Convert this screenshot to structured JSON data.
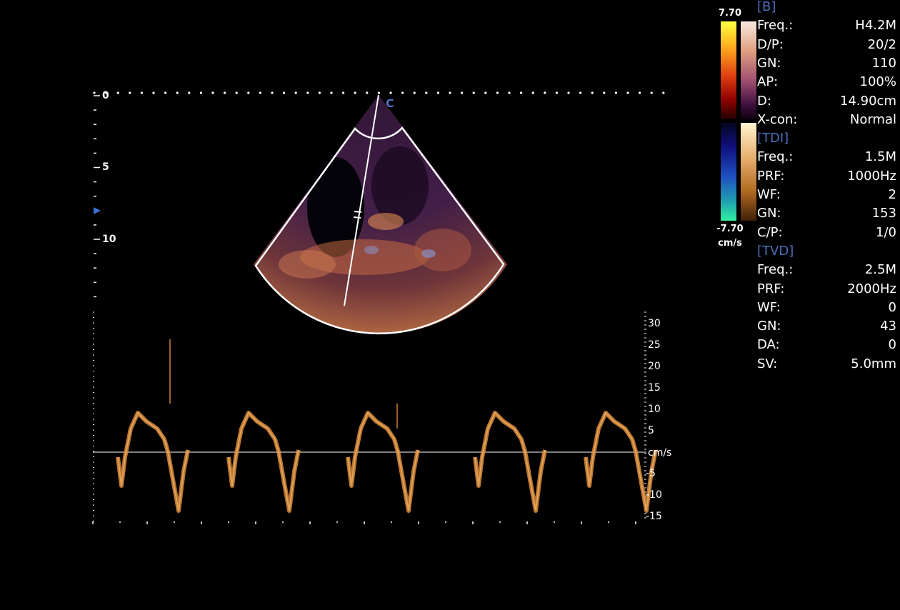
{
  "colorbar": {
    "top_label": "7.70",
    "bottom_label": "-7.70",
    "unit": "cm/s"
  },
  "depth_scale": {
    "labels": [
      "0",
      "5",
      "10"
    ],
    "probe_marker": "C"
  },
  "doppler": {
    "unit_label": "cm/s",
    "velocity_labels": [
      "30",
      "25",
      "20",
      "15",
      "10",
      "5",
      "-5",
      "-10",
      "-15"
    ]
  },
  "params": {
    "b_section": "[B]",
    "b": [
      {
        "k": "Freq.:",
        "v": "H4.2M"
      },
      {
        "k": "D/P:",
        "v": "20/2"
      },
      {
        "k": "GN:",
        "v": "110"
      },
      {
        "k": "AP:",
        "v": "100%"
      },
      {
        "k": "D:",
        "v": "14.90cm"
      },
      {
        "k": "X-con:",
        "v": "Normal"
      }
    ],
    "tdi_section": "[TDI]",
    "tdi": [
      {
        "k": "Freq.:",
        "v": "1.5M"
      },
      {
        "k": "PRF:",
        "v": "1000Hz"
      },
      {
        "k": "WF:",
        "v": "2"
      },
      {
        "k": "GN:",
        "v": "153"
      },
      {
        "k": "C/P:",
        "v": "1/0"
      }
    ],
    "tvd_section": "[TVD]",
    "tvd": [
      {
        "k": "Freq.:",
        "v": "2.5M"
      },
      {
        "k": "PRF:",
        "v": "2000Hz"
      },
      {
        "k": "WF:",
        "v": "0"
      },
      {
        "k": "GN:",
        "v": "43"
      },
      {
        "k": "DA:",
        "v": "0"
      },
      {
        "k": "SV:",
        "v": "5.0mm"
      }
    ]
  },
  "colors": {
    "section_header": "#4f6fc0",
    "doppler_trace": "#d9893a"
  }
}
